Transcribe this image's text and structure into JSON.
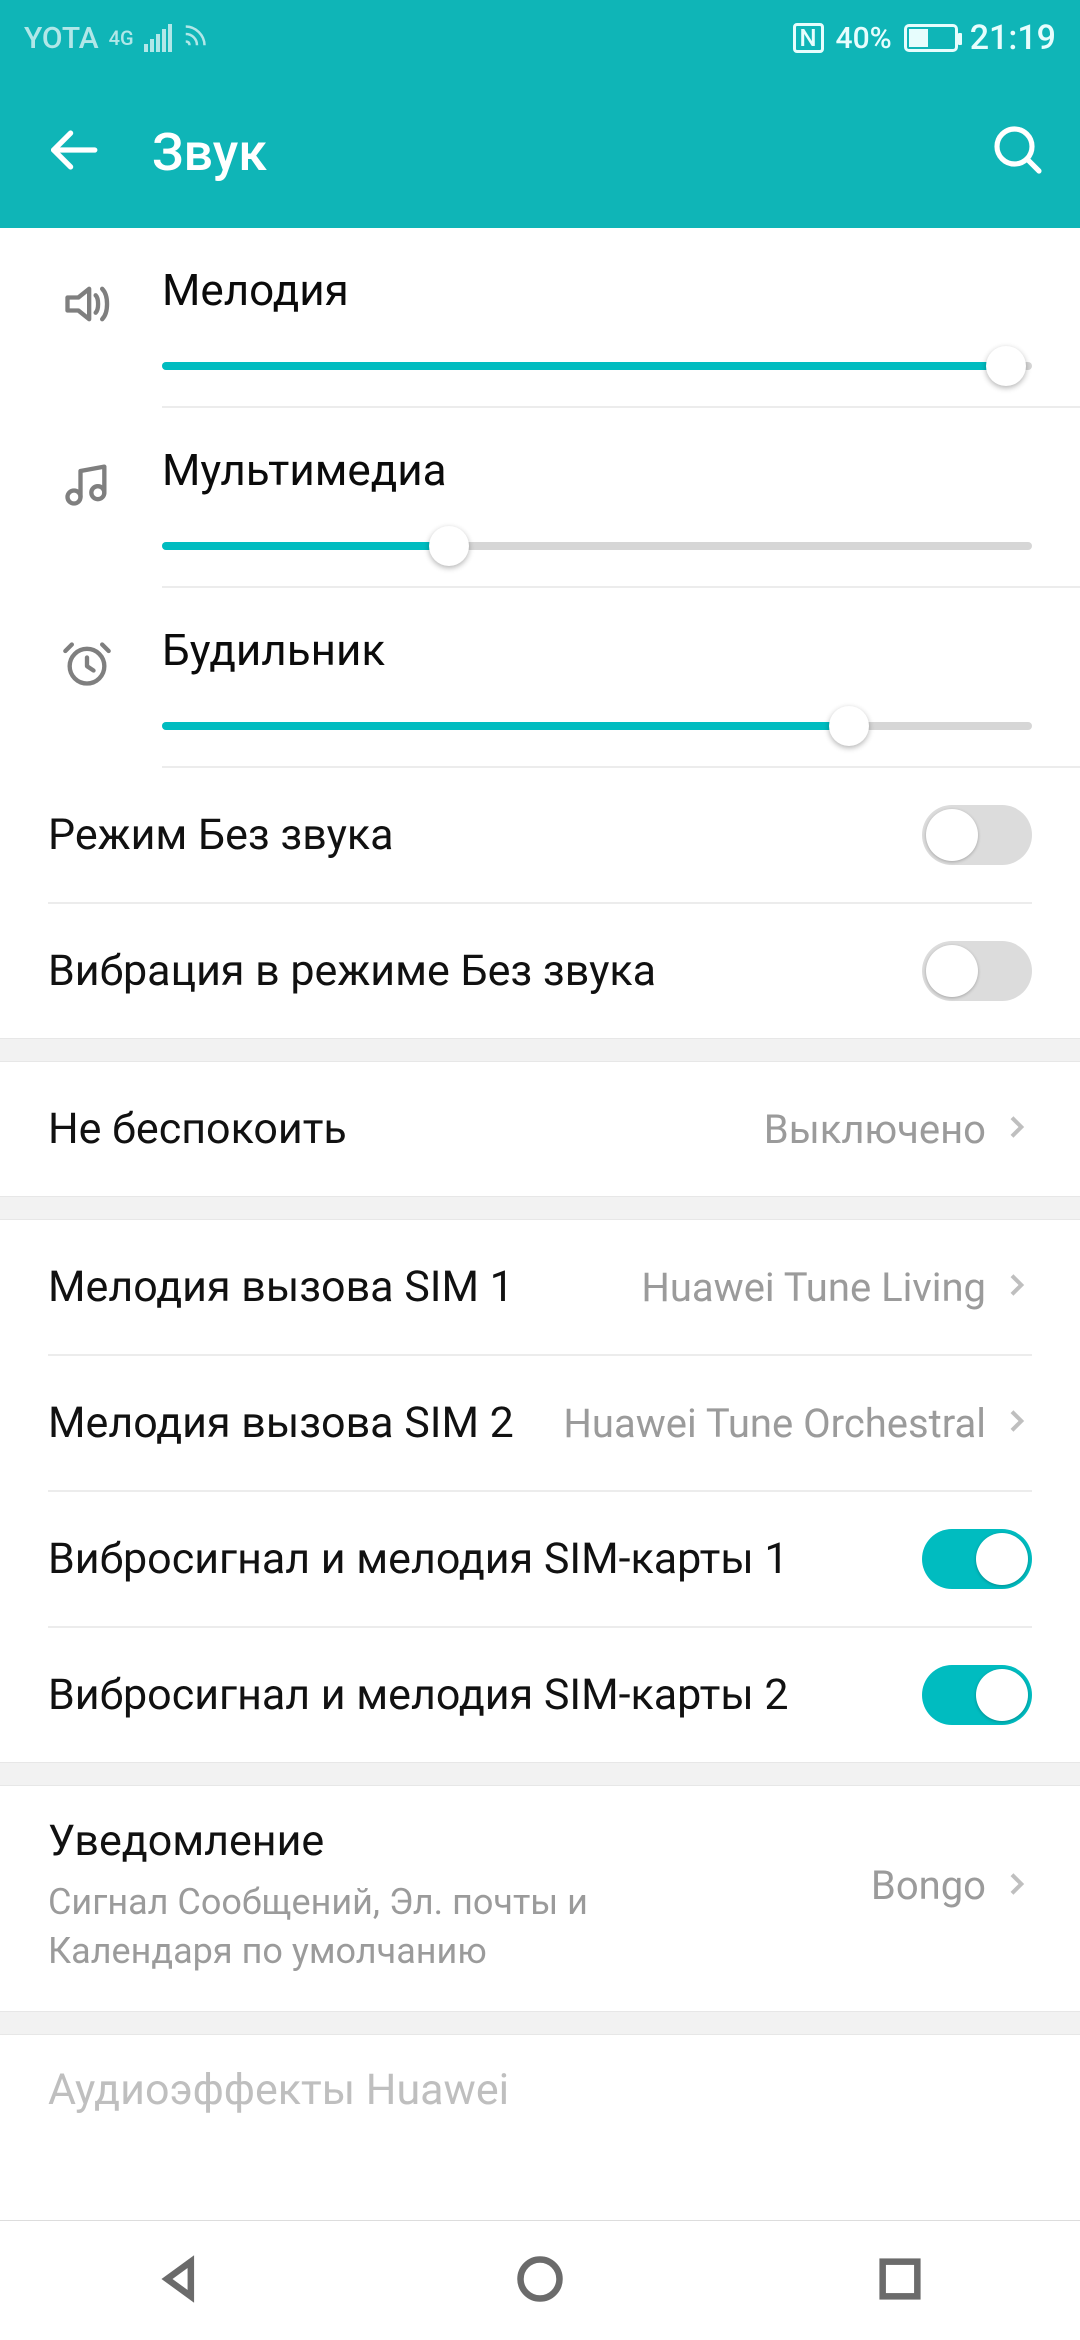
{
  "status": {
    "carrier": "YOTA",
    "net": "4G",
    "battery_pct": "40%",
    "time": "21:19"
  },
  "header": {
    "title": "Звук"
  },
  "sliders": {
    "ringtone": {
      "label": "Мелодия",
      "value": 97
    },
    "media": {
      "label": "Мультимедиа",
      "value": 33
    },
    "alarm": {
      "label": "Будильник",
      "value": 79
    }
  },
  "toggles": {
    "silent": {
      "label": "Режим Без звука",
      "on": false
    },
    "vibrate_silent": {
      "label": "Вибрация в режиме Без звука",
      "on": false
    },
    "vibrate_sim1": {
      "label": "Вибросигнал и мелодия SIM-карты 1",
      "on": true
    },
    "vibrate_sim2": {
      "label": "Вибросигнал и мелодия SIM-карты 2",
      "on": true
    }
  },
  "items": {
    "dnd": {
      "label": "Не беспокоить",
      "value": "Выключено"
    },
    "sim1": {
      "label": "Мелодия вызова SIM 1",
      "value": "Huawei Tune Living"
    },
    "sim2": {
      "label": "Мелодия вызова SIM 2",
      "value": "Huawei Tune Orchestral"
    },
    "notification": {
      "label": "Уведомление",
      "sub": "Сигнал Сообщений, Эл. почты и Календаря по умолчанию",
      "value": "Bongo"
    },
    "audio_effects": {
      "label": "Аудиоэффекты Huawei"
    }
  }
}
